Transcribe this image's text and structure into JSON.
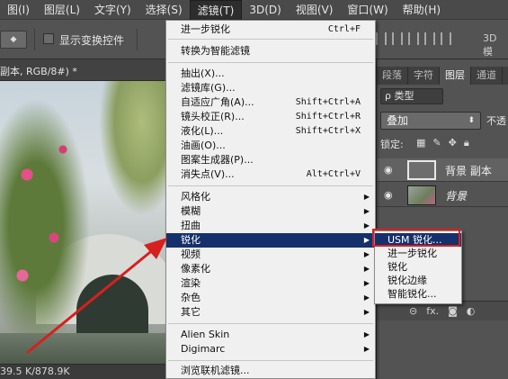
{
  "menubar": {
    "items": [
      "图(I)",
      "图层(L)",
      "文字(Y)",
      "选择(S)",
      "滤镜(T)",
      "3D(D)",
      "视图(V)",
      "窗口(W)",
      "帮助(H)"
    ],
    "active_index": 4
  },
  "options": {
    "checkbox_label": "显示变换控件",
    "mode_3d": "3D 模"
  },
  "document": {
    "tab_label": "副本, RGB/8#) *",
    "status": "39.5 K/878.9K"
  },
  "filter_menu": {
    "items": [
      {
        "label": "进一步锐化",
        "shortcut": "Ctrl+F"
      },
      {
        "label": "转换为智能滤镜"
      },
      {
        "label": "抽出(X)..."
      },
      {
        "label": "滤镜库(G)..."
      },
      {
        "label": "自适应广角(A)...",
        "shortcut": "Shift+Ctrl+A"
      },
      {
        "label": "镜头校正(R)...",
        "shortcut": "Shift+Ctrl+R"
      },
      {
        "label": "液化(L)...",
        "shortcut": "Shift+Ctrl+X"
      },
      {
        "label": "油画(O)..."
      },
      {
        "label": "图案生成器(P)..."
      },
      {
        "label": "消失点(V)...",
        "shortcut": "Alt+Ctrl+V"
      },
      {
        "label": "风格化"
      },
      {
        "label": "模糊"
      },
      {
        "label": "扭曲"
      },
      {
        "label": "锐化"
      },
      {
        "label": "视频"
      },
      {
        "label": "像素化"
      },
      {
        "label": "渲染"
      },
      {
        "label": "杂色"
      },
      {
        "label": "其它"
      },
      {
        "label": "Alien Skin"
      },
      {
        "label": "Digimarc"
      },
      {
        "label": "浏览联机滤镜..."
      }
    ]
  },
  "sharpen_submenu": {
    "items": [
      "USM 锐化...",
      "进一步锐化",
      "锐化",
      "锐化边缘",
      "智能锐化..."
    ]
  },
  "layers_panel": {
    "tabs": [
      "段落",
      "字符",
      "图层",
      "通道"
    ],
    "active_tab": 2,
    "kind_filter": "ρ 类型",
    "blend_mode": "叠加",
    "opacity_label": "不透",
    "lock_label": "锁定:",
    "layers": [
      {
        "name": "背景 副本",
        "selected": true
      },
      {
        "name": "背景",
        "selected": false
      }
    ]
  },
  "colors": {
    "highlight": "#16306b",
    "annotation_red": "#d62020"
  }
}
